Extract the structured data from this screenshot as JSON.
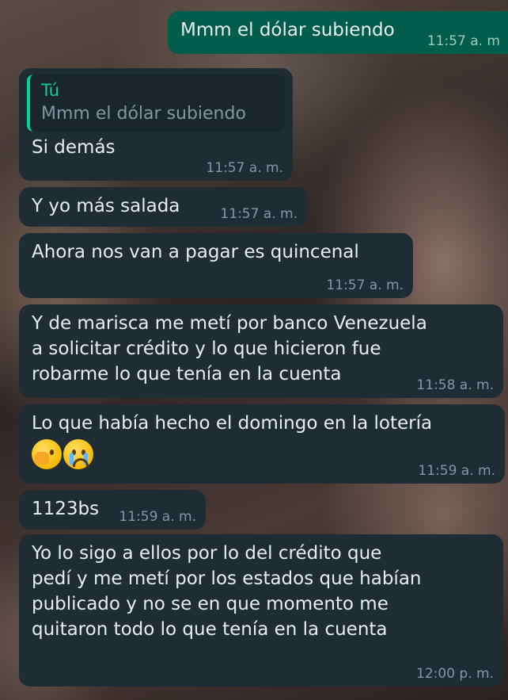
{
  "colors": {
    "incoming_bubble": "#1f2c34",
    "outgoing_bubble": "#005c4b",
    "quote_accent": "#06cf9c",
    "timestamp": "#8696a0"
  },
  "messages": [
    {
      "direction": "out",
      "text": "Mmm el dólar subiendo",
      "time": "11:57 a. m"
    },
    {
      "direction": "in",
      "quote_author": "Tú",
      "quote_text": "Mmm el dólar subiendo",
      "text": "Si demás",
      "time": "11:57 a. m."
    },
    {
      "direction": "in",
      "text": "Y yo más salada",
      "time": "11:57 a. m."
    },
    {
      "direction": "in",
      "text": "Ahora nos van a pagar es quincenal",
      "time": "11:57 a. m."
    },
    {
      "direction": "in",
      "text": "Y de marisca me metí por banco Venezuela\na solicitar crédito y lo que hicieron fue\nrobarme lo que tenía en la cuenta",
      "time": "11:58 a. m."
    },
    {
      "direction": "in",
      "text": "Lo que había hecho el domingo en la lotería",
      "emojis": [
        "face-with-hand-over-eyes-icon",
        "loudly-crying-face-icon"
      ],
      "time": "11:59 a. m."
    },
    {
      "direction": "in",
      "text": "1123bs",
      "time": "11:59 a. m."
    },
    {
      "direction": "in",
      "text": "Yo lo sigo a ellos por lo del crédito que\npedí y me metí por los estados que habían\npublicado y no se en que momento me\nquitaron todo lo que tenía en la cuenta",
      "time": "12:00 p. m."
    }
  ]
}
